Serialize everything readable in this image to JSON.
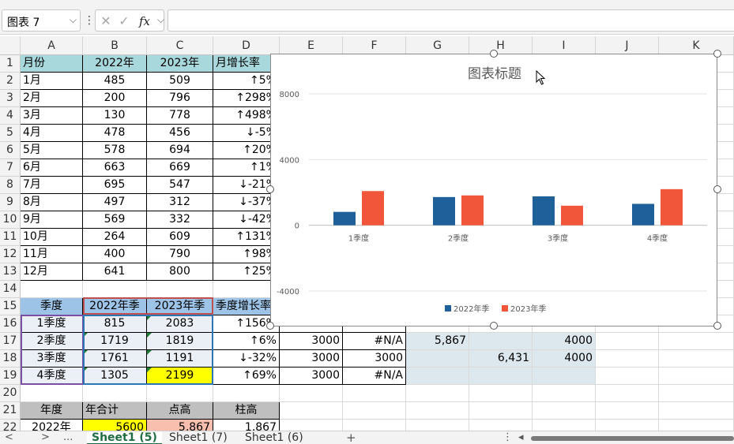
{
  "formula_bar": {
    "name_box": "图表 7",
    "fx_label": "fx",
    "formula_value": ""
  },
  "columns": [
    "A",
    "B",
    "C",
    "D",
    "E",
    "F",
    "G",
    "H",
    "I",
    "J",
    "K"
  ],
  "rows": [
    {
      "n": "1",
      "cells": [
        "月份",
        "2022年",
        "2023年",
        "月增长率"
      ]
    },
    {
      "n": "2",
      "cells": [
        "1月",
        "485",
        "509",
        "↑5%"
      ]
    },
    {
      "n": "3",
      "cells": [
        "2月",
        "200",
        "796",
        "↑298%"
      ]
    },
    {
      "n": "4",
      "cells": [
        "3月",
        "130",
        "778",
        "↑498%"
      ]
    },
    {
      "n": "5",
      "cells": [
        "4月",
        "478",
        "456",
        "↓-5%"
      ]
    },
    {
      "n": "6",
      "cells": [
        "5月",
        "578",
        "694",
        "↑20%"
      ]
    },
    {
      "n": "7",
      "cells": [
        "6月",
        "663",
        "669",
        "↑1%"
      ]
    },
    {
      "n": "8",
      "cells": [
        "7月",
        "695",
        "547",
        "↓-21%"
      ]
    },
    {
      "n": "9",
      "cells": [
        "8月",
        "497",
        "312",
        "↓-37%"
      ]
    },
    {
      "n": "10",
      "cells": [
        "9月",
        "569",
        "332",
        "↓-42%"
      ]
    },
    {
      "n": "11",
      "cells": [
        "10月",
        "264",
        "609",
        "↑131%"
      ]
    },
    {
      "n": "12",
      "cells": [
        "11月",
        "400",
        "790",
        "↑98%"
      ]
    },
    {
      "n": "13",
      "cells": [
        "12月",
        "641",
        "800",
        "↑25%"
      ]
    },
    {
      "n": "14",
      "cells": []
    },
    {
      "n": "15",
      "cells": [
        "季度",
        "2022年季",
        "2023年季",
        "季度增长率"
      ]
    },
    {
      "n": "16",
      "cells": [
        "1季度",
        "815",
        "2083",
        "↑156%"
      ]
    },
    {
      "n": "17",
      "cells": [
        "2季度",
        "1719",
        "1819",
        "↑6%",
        "3000",
        "#N/A",
        "5,867",
        "",
        "4000"
      ]
    },
    {
      "n": "18",
      "cells": [
        "3季度",
        "1761",
        "1191",
        "↓-32%",
        "3000",
        "3000",
        "",
        "6,431",
        "4000"
      ]
    },
    {
      "n": "19",
      "cells": [
        "4季度",
        "1305",
        "2199",
        "↑69%",
        "3000",
        "#N/A"
      ]
    },
    {
      "n": "20",
      "cells": []
    },
    {
      "n": "21",
      "cells": [
        "年度",
        "年合计",
        "点高",
        "柱高"
      ]
    },
    {
      "n": "22",
      "cells": [
        "2022年",
        "5600",
        "5,867",
        "1,867"
      ]
    }
  ],
  "chart": {
    "title": "图表标题"
  },
  "chart_data": {
    "type": "bar",
    "title": "图表标题",
    "categories": [
      "1季度",
      "2季度",
      "3季度",
      "4季度"
    ],
    "series": [
      {
        "name": "2022年季",
        "values": [
          815,
          1719,
          1761,
          1305
        ],
        "color": "#1f5f9a"
      },
      {
        "name": "2023年季",
        "values": [
          2083,
          1819,
          1191,
          2199
        ],
        "color": "#f2563a"
      }
    ],
    "y_ticks": [
      "8000",
      "4000",
      "0",
      "-4000"
    ],
    "ylim": [
      -4000,
      8000
    ],
    "grid": true,
    "legend": "bottom"
  },
  "tabs": {
    "nav_prev": "<",
    "nav_next": ">",
    "nav_more": "...",
    "sheets": [
      "Sheet1 (5)",
      "Sheet1 (7)",
      "Sheet1 (6)"
    ],
    "add": "+",
    "menu": "⋮"
  }
}
